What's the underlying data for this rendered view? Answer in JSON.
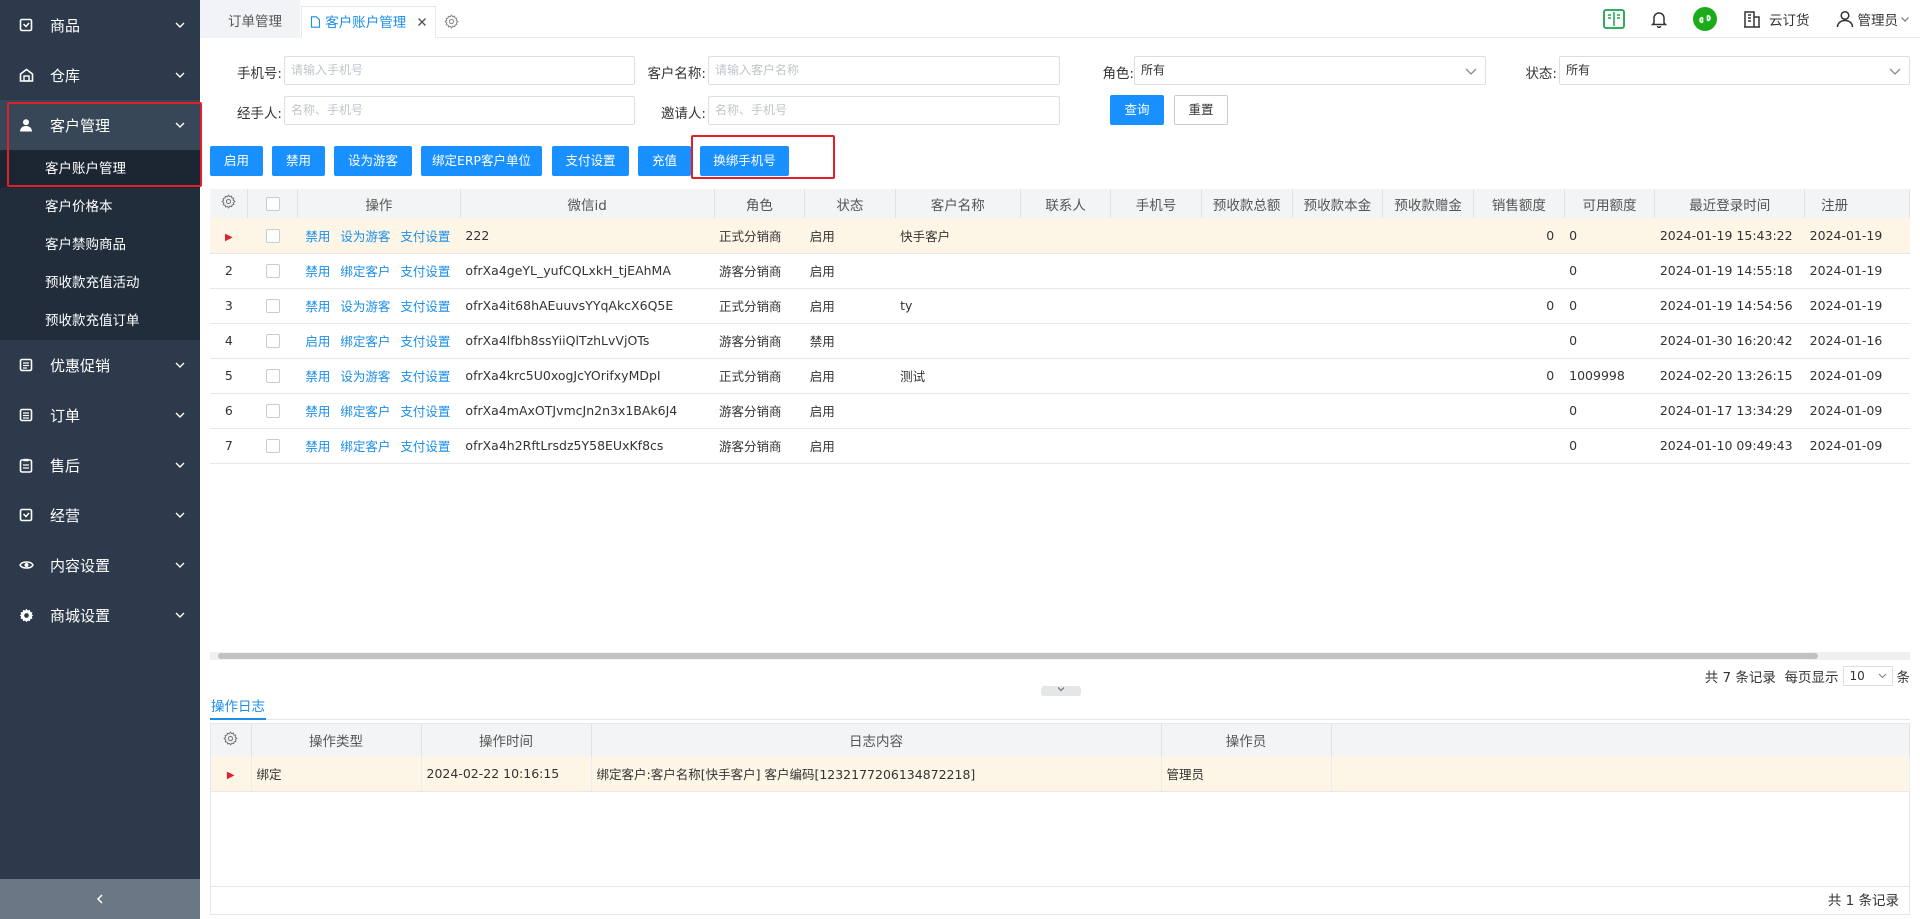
{
  "sidebar": {
    "menus": [
      {
        "label": "商品",
        "icon": "product-icon"
      },
      {
        "label": "仓库",
        "icon": "warehouse-icon"
      },
      {
        "label": "客户管理",
        "icon": "user-icon"
      },
      {
        "label": "优惠促销",
        "icon": "promotion-icon"
      },
      {
        "label": "订单",
        "icon": "order-icon"
      },
      {
        "label": "售后",
        "icon": "aftersale-icon"
      },
      {
        "label": "经营",
        "icon": "business-icon"
      },
      {
        "label": "内容设置",
        "icon": "eye-icon"
      },
      {
        "label": "商城设置",
        "icon": "gear-icon"
      }
    ],
    "sub_items": [
      "客户账户管理",
      "客户价格本",
      "客户禁购商品",
      "预收款充值活动",
      "预收款充值订单"
    ]
  },
  "tabs": {
    "order": "订单管理",
    "customer": "客户账户管理"
  },
  "header": {
    "company": "云订货",
    "user": "管理员"
  },
  "filter": {
    "phone_label": "手机号:",
    "phone_placeholder": "请输入手机号",
    "name_label": "客户名称:",
    "name_placeholder": "请输入客户名称",
    "role_label": "角色:",
    "role_value": "所有",
    "status_label": "状态:",
    "status_value": "所有",
    "handler_label": "经手人:",
    "handler_placeholder": "名称、手机号",
    "inviter_label": "邀请人:",
    "inviter_placeholder": "名称、手机号",
    "query": "查询",
    "reset": "重置"
  },
  "toolbar": [
    "启用",
    "禁用",
    "设为游客",
    "绑定ERP客户单位",
    "支付设置",
    "充值",
    "换绑手机号"
  ],
  "grid": {
    "columns": [
      "操作",
      "微信id",
      "角色",
      "状态",
      "客户名称",
      "联系人",
      "手机号",
      "预收款总额",
      "预收款本金",
      "预收款赠金",
      "销售额度",
      "可用额度",
      "最近登录时间",
      "注册"
    ],
    "rows": [
      {
        "no": "",
        "ops": [
          "禁用",
          "设为游客",
          "支付设置"
        ],
        "wx": "222",
        "role": "正式分销商",
        "status": "启用",
        "name": "快手客户",
        "sales": "0",
        "avail": "0",
        "login": "2024-01-19 15:43:22",
        "reg": "2024-01-19"
      },
      {
        "no": "2",
        "ops": [
          "禁用",
          "绑定客户",
          "支付设置"
        ],
        "wx": "ofrXa4geYL_yufCQLxkH_tjEAhMA",
        "role": "游客分销商",
        "status": "启用",
        "name": "",
        "sales": "",
        "avail": "0",
        "login": "2024-01-19 14:55:18",
        "reg": "2024-01-19"
      },
      {
        "no": "3",
        "ops": [
          "禁用",
          "设为游客",
          "支付设置"
        ],
        "wx": "ofrXa4it68hAEuuvsYYqAkcX6Q5E",
        "role": "正式分销商",
        "status": "启用",
        "name": "ty",
        "sales": "0",
        "avail": "0",
        "login": "2024-01-19 14:54:56",
        "reg": "2024-01-19"
      },
      {
        "no": "4",
        "ops": [
          "启用",
          "绑定客户",
          "支付设置"
        ],
        "wx": "ofrXa4lfbh8ssYiiQlTzhLvVjOTs",
        "role": "游客分销商",
        "status": "禁用",
        "name": "",
        "sales": "",
        "avail": "0",
        "login": "2024-01-30 16:20:42",
        "reg": "2024-01-16"
      },
      {
        "no": "5",
        "ops": [
          "禁用",
          "设为游客",
          "支付设置"
        ],
        "wx": "ofrXa4krc5U0xogJcYOrifxyMDpI",
        "role": "正式分销商",
        "status": "启用",
        "name": "测试",
        "sales": "0",
        "avail": "1009998",
        "login": "2024-02-20 13:26:15",
        "reg": "2024-01-09"
      },
      {
        "no": "6",
        "ops": [
          "禁用",
          "绑定客户",
          "支付设置"
        ],
        "wx": "ofrXa4mAxOTJvmcJn2n3x1BAk6J4",
        "role": "游客分销商",
        "status": "启用",
        "name": "",
        "sales": "",
        "avail": "0",
        "login": "2024-01-17 13:34:29",
        "reg": "2024-01-09"
      },
      {
        "no": "7",
        "ops": [
          "禁用",
          "绑定客户",
          "支付设置"
        ],
        "wx": "ofrXa4h2RftLrsdz5Y58EUxKf8cs",
        "role": "游客分销商",
        "status": "启用",
        "name": "",
        "sales": "",
        "avail": "0",
        "login": "2024-01-10 09:49:43",
        "reg": "2024-01-09"
      }
    ]
  },
  "pager": {
    "prefix": "共 7 条记录  每页显示",
    "size": "10",
    "suffix": "条"
  },
  "log": {
    "tab": "操作日志",
    "columns": [
      "操作类型",
      "操作时间",
      "日志内容",
      "操作员"
    ],
    "row": {
      "type": "绑定",
      "time": "2024-02-22 10:16:15",
      "content": "绑定客户:客户名称[快手客户] 客户编码[1232177206134872218]",
      "operator": "管理员"
    },
    "footer": "共 1 条记录"
  },
  "colors": {
    "sidebar_bg": "#2d3a4b",
    "primary": "#1890ff",
    "highlight": "#e0212b",
    "selected_row": "#fdf6e6"
  }
}
